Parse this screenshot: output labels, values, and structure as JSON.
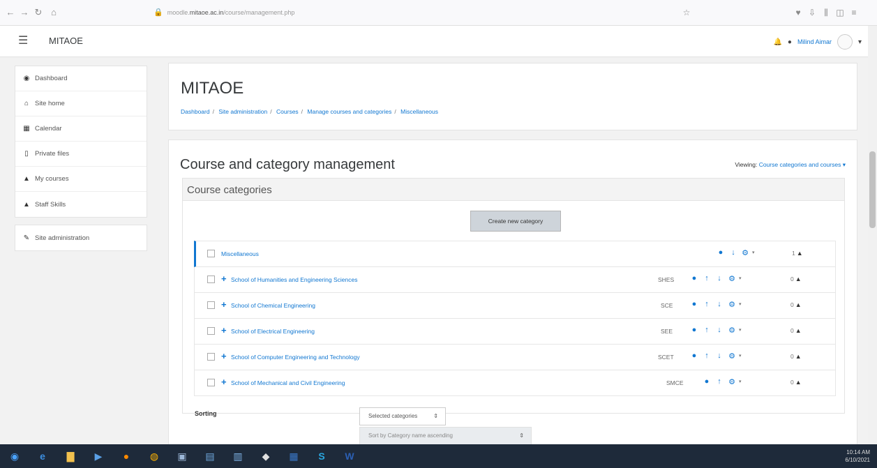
{
  "browser": {
    "url_prefix": "moodle.",
    "url_domain": "mitaoe.ac.in",
    "url_path": "/course/management.php"
  },
  "navbar": {
    "brand": "MITAOE",
    "user_name": "Milind Aimar"
  },
  "sidebar": {
    "group1": [
      {
        "label": "Dashboard",
        "icon": "dashboard-icon"
      },
      {
        "label": "Site home",
        "icon": "home-icon"
      },
      {
        "label": "Calendar",
        "icon": "calendar-icon"
      },
      {
        "label": "Private files",
        "icon": "file-icon"
      },
      {
        "label": "My courses",
        "icon": "graduation-cap-icon"
      },
      {
        "label": "Staff Skills",
        "icon": "graduation-cap-icon"
      }
    ],
    "group2": [
      {
        "label": "Site administration",
        "icon": "wrench-icon"
      }
    ]
  },
  "header": {
    "title": "MITAOE",
    "breadcrumb": [
      "Dashboard",
      "Site administration",
      "Courses",
      "Manage courses and categories",
      "Miscellaneous"
    ]
  },
  "main": {
    "title": "Course and category management",
    "viewing_label": "Viewing:",
    "viewing_value": "Course categories and courses",
    "categories_header": "Course categories",
    "create_button": "Create new category",
    "categories": [
      {
        "name": "Miscellaneous",
        "idnumber": "",
        "count": "1"
      },
      {
        "name": "School of Humanities and Engineering Sciences",
        "idnumber": "SHES",
        "count": "0"
      },
      {
        "name": "School of Chemical Engineering",
        "idnumber": "SCE",
        "count": "0"
      },
      {
        "name": "School of Electrical Engineering",
        "idnumber": "SEE",
        "count": "0"
      },
      {
        "name": "School of Computer Engineering and Technology",
        "idnumber": "SCET",
        "count": "0"
      },
      {
        "name": "School of Mechanical and Civil Engineering",
        "idnumber": "SMCE",
        "count": "0"
      }
    ],
    "sorting_label": "Sorting",
    "sort_select_1": "Selected categories",
    "sort_select_2": "Sort by Category name ascending"
  },
  "taskbar": {
    "time": "10:14 AM",
    "date": "6/10/2021"
  },
  "colors": {
    "link": "#1177d1",
    "active_border": "#1177d1",
    "button_bg": "#ced4da",
    "taskbar_bg": "#1e2a3a"
  }
}
